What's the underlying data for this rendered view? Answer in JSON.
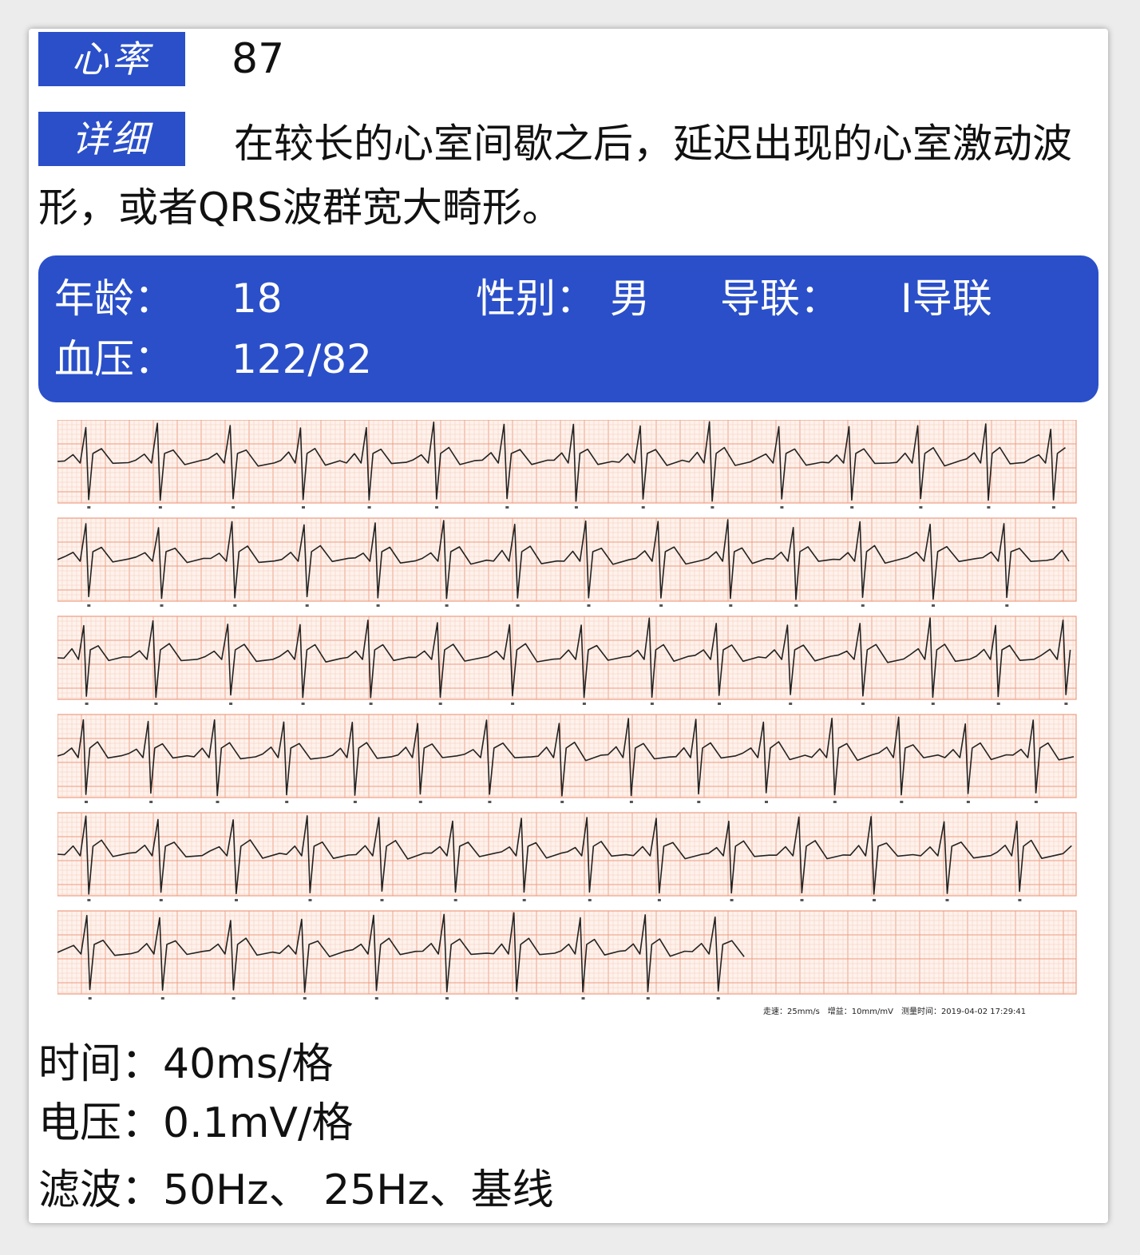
{
  "heart_rate": {
    "label": "心率",
    "value": "87"
  },
  "detail": {
    "label": "详细",
    "text": "在较长的心室间歇之后，延迟出现的心室激动波形，或者QRS波群宽大畸形。"
  },
  "patient": {
    "age_label": "年龄：",
    "age": "18",
    "sex_label": "性别：",
    "sex": "男",
    "lead_label": "导联：",
    "lead": "I导联",
    "bp_label": "血压：",
    "bp": "122/82"
  },
  "ecg": {
    "footer": "走速：25mm/s　增益：10mm/mV　测量时间：2019-04-02 17:29:41",
    "colors": {
      "grid": "#f6c7b3",
      "grid_major": "#ee9b80",
      "trace": "#222222",
      "bg": "#fdf2ec"
    }
  },
  "settings": {
    "time_label": "时间：",
    "time": "40ms/格",
    "voltage_label": "电压：",
    "voltage": "0.1mV/格",
    "filter_label": "滤波：",
    "filter": "50Hz、 25Hz、基线"
  },
  "colors": {
    "accent": "#2a4fc9"
  }
}
